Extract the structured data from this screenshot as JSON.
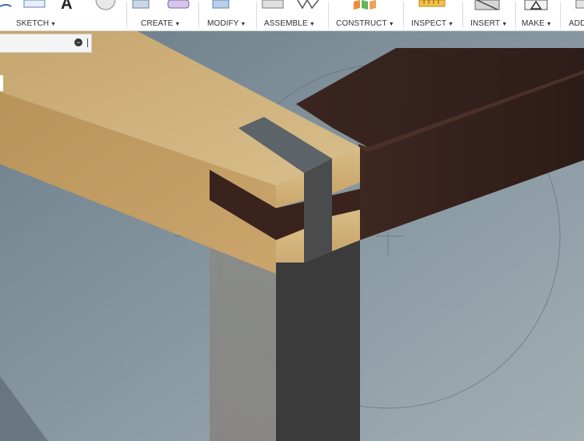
{
  "toolbar": {
    "groups": [
      {
        "label": "SKETCH"
      },
      {
        "label": "CREATE"
      },
      {
        "label": "MODIFY"
      },
      {
        "label": "ASSEMBLE"
      },
      {
        "label": "CONSTRUCT"
      },
      {
        "label": "INSPECT"
      },
      {
        "label": "INSERT"
      },
      {
        "label": "MAKE"
      },
      {
        "label": "ADD"
      }
    ]
  },
  "colors": {
    "background": "#8a9aa3",
    "light_wood": "#c9a56f",
    "dark_wood": "#3a2620",
    "section_gray": "#3d3d3d"
  }
}
